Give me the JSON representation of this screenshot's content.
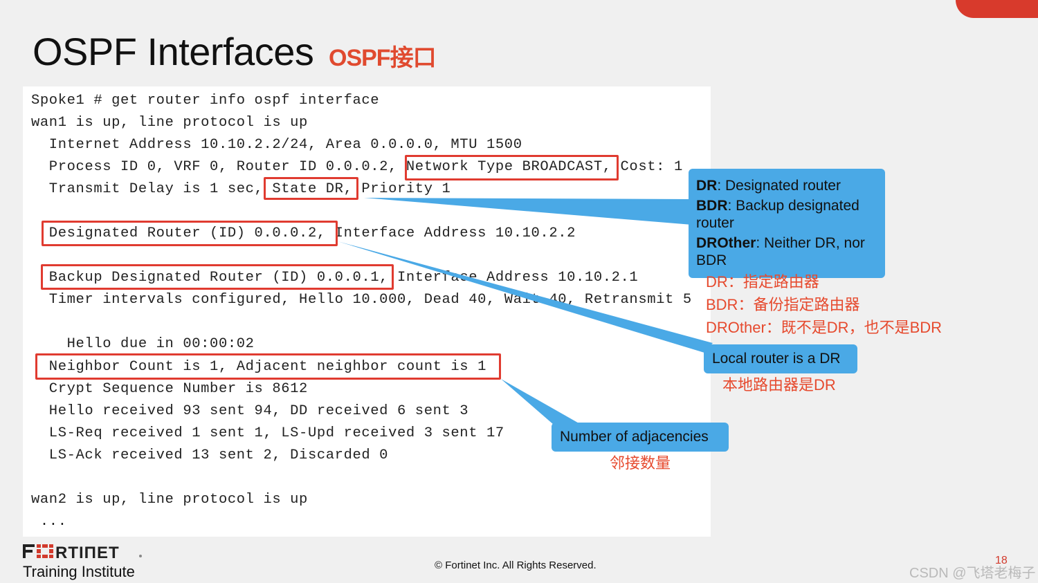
{
  "slide": {
    "title": "OSPF Interfaces",
    "title_cn": "OSPF接口",
    "accent_color": "#d83a2c",
    "callout_color": "#4aa9e6",
    "annotation_color": "#e64a2e"
  },
  "terminal": {
    "lines": [
      "Spoke1 # get router info ospf interface",
      "wan1 is up, line protocol is up",
      "  Internet Address 10.10.2.2/24, Area 0.0.0.0, MTU 1500",
      "  Process ID 0, VRF 0, Router ID 0.0.0.2, Network Type BROADCAST, Cost: 1",
      "  Transmit Delay is 1 sec, State DR, Priority 1",
      "",
      "  Designated Router (ID) 0.0.0.2, Interface Address 10.10.2.2",
      "",
      "  Backup Designated Router (ID) 0.0.0.1, Interface Address 10.10.2.1",
      "  Timer intervals configured, Hello 10.000, Dead 40, Wait 40, Retransmit 5",
      "",
      "    Hello due in 00:00:02",
      "  Neighbor Count is 1, Adjacent neighbor count is 1",
      "  Crypt Sequence Number is 8612",
      "  Hello received 93 sent 94, DD received 6 sent 3",
      "  LS-Req received 1 sent 1, LS-Upd received 3 sent 17",
      "  LS-Ack received 13 sent 2, Discarded 0",
      "",
      "wan2 is up, line protocol is up",
      " ..."
    ],
    "highlights": [
      "Network Type BROADCAST",
      "State DR",
      "Designated Router (ID) 0.0.0.2",
      "Backup Designated Router (ID) 0.0.0.1",
      "Neighbor Count is 1, Adjacent neighbor count is 1"
    ]
  },
  "callouts": {
    "roles": {
      "dr_term": "DR",
      "dr_desc": ": Designated router",
      "bdr_term": "BDR",
      "bdr_desc": ": Backup designated router",
      "drother_term": "DROther",
      "drother_desc": ": Neither DR, nor BDR"
    },
    "roles_cn": [
      "DR：指定路由器",
      "BDR：备份指定路由器",
      "DROther：既不是DR，也不是BDR"
    ],
    "local_dr": "Local router is a DR",
    "local_dr_cn": "本地路由器是DR",
    "adjacencies": "Number of adjacencies",
    "adjacencies_cn": "邻接数量"
  },
  "footer": {
    "logo": "FORTINET",
    "subtitle": "Training Institute",
    "copyright": "© Fortinet Inc. All Rights Reserved.",
    "page_number": "18",
    "watermark": "CSDN @飞塔老梅子"
  }
}
